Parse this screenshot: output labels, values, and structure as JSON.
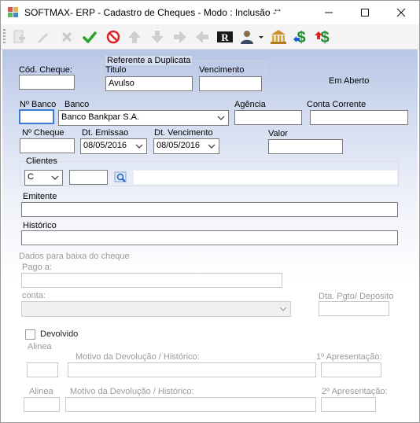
{
  "window": {
    "title": "SOFTMAX- ERP - Cadastro de Cheques  - Modo : Inclusão -",
    "resize_glyph": "↔",
    "minimize": "—",
    "maximize": "☐",
    "close": "✕"
  },
  "toolbar": {
    "items": [
      "new-icon",
      "edit-icon",
      "delete-icon",
      "save-check-icon",
      "cancel-icon",
      "up-arrow-icon",
      "down-arrow-icon",
      "right-arrow-icon",
      "left-arrow-icon",
      "report-icon",
      "user-icon",
      "bank-icon",
      "dollar-green-icon",
      "dollar-red-icon"
    ]
  },
  "form": {
    "cod_cheque_label": "Cód. Cheque:",
    "cod_cheque_value": "",
    "ref_group_title": "Referente a Duplicata",
    "titulo_label": "Titulo",
    "titulo_value": "Avulso",
    "vencimento_label": "Vencimento",
    "vencimento_value": "",
    "status_text": "Em Aberto",
    "nbanco_label": "Nº Banco",
    "nbanco_value": "",
    "banco_label": "Banco",
    "banco_value": "Banco Bankpar S.A.",
    "agencia_label": "Agência",
    "agencia_value": "",
    "conta_corrente_label": "Conta Corrente",
    "conta_corrente_value": "",
    "ncheque_label": "Nº Cheque",
    "ncheque_value": "",
    "dt_emissao_label": "Dt. Emissao",
    "dt_emissao_value": "08/05/2016",
    "dt_vencimento_label": "Dt. Vencimento",
    "dt_vencimento_value": "08/05/2016",
    "valor_label": "Valor",
    "valor_value": "",
    "clientes_label": "Clientes",
    "clientes_type_value": "C",
    "clientes_code_value": "",
    "clientes_name_value": "",
    "emitente_label": "Emitente",
    "emitente_value": "",
    "historico_label": "Histórico",
    "historico_value": ""
  },
  "baixa": {
    "section_label": "Dados para baixa do cheque",
    "pago_label": "Pago a:",
    "pago_value": "",
    "conta_label": "conta:",
    "conta_value": "",
    "dt_pgto_label": "Dta. Pgto/ Deposito",
    "dt_pgto_value": ""
  },
  "devolucao": {
    "devolvido_label": "Devolvido",
    "alinea1_label": "Alinea",
    "motivo1_label": "Motivo da Devolução / Histórico:",
    "apres1_label": "1º Apresentação:",
    "alinea2_label": "Alinea",
    "motivo2_label": "Motivo da Devolução / Histórico:",
    "apres2_label": "2º Apresentação:"
  }
}
